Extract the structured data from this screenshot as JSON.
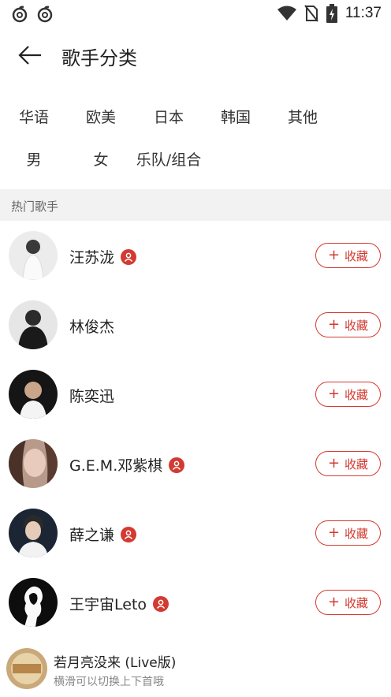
{
  "status": {
    "time": "11:37",
    "left_icons": [
      "netease-music-icon",
      "netease-music-icon"
    ],
    "right_icons": [
      "wifi-icon",
      "no-sim-icon",
      "battery-charging-icon"
    ]
  },
  "header": {
    "back_icon": "arrow-left-icon",
    "title": "歌手分类"
  },
  "categories": {
    "region": [
      "华语",
      "欧美",
      "日本",
      "韩国",
      "其他"
    ],
    "type": [
      "男",
      "女",
      "乐队/组合"
    ]
  },
  "section": {
    "title": "热门歌手"
  },
  "artists": [
    {
      "name": "汪苏泷",
      "verified": true,
      "action": "收藏",
      "action_icon": "plus-icon"
    },
    {
      "name": "林俊杰",
      "verified": false,
      "action": "收藏",
      "action_icon": "plus-icon"
    },
    {
      "name": "陈奕迅",
      "verified": false,
      "action": "收藏",
      "action_icon": "plus-icon"
    },
    {
      "name": "G.E.M.邓紫棋",
      "verified": true,
      "action": "收藏",
      "action_icon": "plus-icon"
    },
    {
      "name": "薛之谦",
      "verified": true,
      "action": "收藏",
      "action_icon": "plus-icon"
    },
    {
      "name": "王宇宙Leto",
      "verified": true,
      "action": "收藏",
      "action_icon": "plus-icon"
    }
  ],
  "player": {
    "song": "若月亮没来 (Live版)",
    "hint": "横滑可以切换上下首哦"
  },
  "colors": {
    "accent": "#d33a31",
    "section_bg": "#f2f2f2"
  }
}
